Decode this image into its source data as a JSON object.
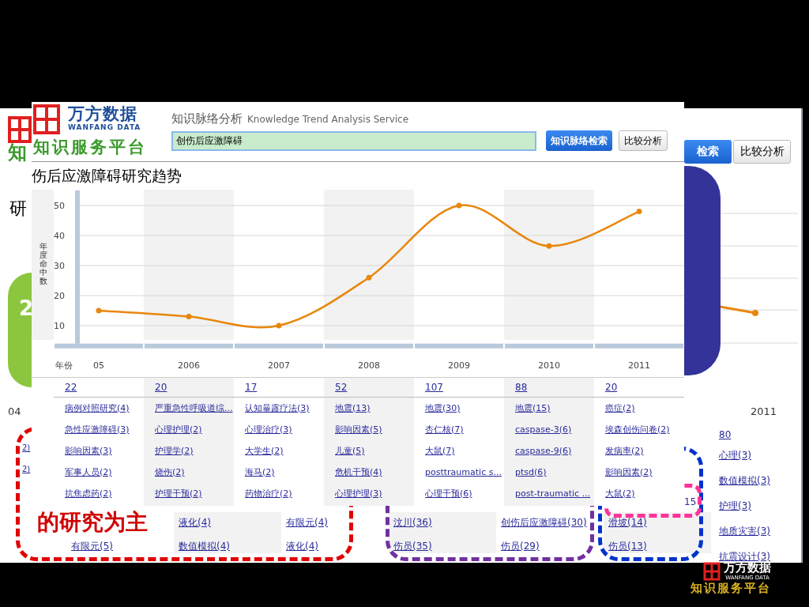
{
  "back_page": {
    "logo_fragment": "知",
    "title_fragment": "研",
    "search_button": "检索",
    "compare_button": "比较分析",
    "green_badge": "2",
    "year_fragment": "04",
    "year": "2011",
    "count": "80",
    "left_items": [
      "2)",
      "2)"
    ],
    "partial_count": "15",
    "right_items": [
      "心理(3)",
      "数值模拟(3)",
      "护理(3)",
      "地质灾害(3)",
      "抗震设计(3)"
    ],
    "bottom_columns": [
      {
        "items": [
          "有限元(5)"
        ]
      },
      {
        "items": [
          "液化(4)",
          "数值模拟(4)"
        ]
      },
      {
        "items": [
          "有限元(4)",
          "液化(4)"
        ]
      },
      {
        "items": [
          "汶川(36)",
          "伤员(35)"
        ]
      },
      {
        "items": [
          "创伤后应激障碍(30)",
          "伤员(29)"
        ]
      },
      {
        "items": [
          "滑坡(14)",
          "伤员(13)"
        ]
      }
    ]
  },
  "annotations": [
    {
      "kind": "dashed-box",
      "color": "#e00000"
    },
    {
      "kind": "dashed-box",
      "color": "#7030a0"
    },
    {
      "kind": "dashed-box",
      "color": "#0033cc"
    },
    {
      "kind": "dashed-box",
      "color": "#ff3399"
    },
    {
      "kind": "block",
      "color": "#333399"
    },
    {
      "kind": "caption",
      "text": "的研究为主"
    }
  ],
  "front_page": {
    "logo": {
      "name": "万方数据",
      "latin": "WANFANG DATA",
      "tagline": "知识服务平台"
    },
    "service_title": "知识脉络分析",
    "service_subtitle": "Knowledge Trend Analysis Service",
    "search": {
      "value": "创伤后应激障碍"
    },
    "buttons": [
      {
        "label": "知识脉络检索",
        "kind": "primary"
      },
      {
        "label": "比较分析",
        "kind": "secondary"
      }
    ],
    "chart_title": "伤后应激障碍研究趋势",
    "chart_data": {
      "type": "line",
      "xlabel": "年份",
      "ylabel": "年度命中数",
      "categories": [
        "05",
        "2006",
        "2007",
        "2008",
        "2009",
        "2010",
        "2011"
      ],
      "series": [
        {
          "color": "#e8870e",
          "values": [
            15,
            13,
            10,
            26,
            50,
            36.5,
            48
          ]
        }
      ],
      "ylim": [
        4,
        55
      ],
      "yticks": [
        10,
        20,
        30,
        40,
        50
      ],
      "grid": true,
      "marker": true
    },
    "years": [
      {
        "count": "22",
        "keywords": [
          "病例对照研究(4)",
          "急性应激障碍(3)",
          "影响因素(3)",
          "军事人员(2)",
          "抗焦虑药(2)"
        ]
      },
      {
        "count": "20",
        "keywords": [
          "严重急性呼吸道综...",
          "心理护理(2)",
          "护理学(2)",
          "烧伤(2)",
          "护理干预(2)"
        ]
      },
      {
        "count": "17",
        "keywords": [
          "认知暴露疗法(3)",
          "心理治疗(3)",
          "大学生(2)",
          "海马(2)",
          "药物治疗(2)"
        ]
      },
      {
        "count": "52",
        "keywords": [
          "地震(13)",
          "影响因素(5)",
          "儿童(5)",
          "危机干预(4)",
          "心理护理(3)"
        ]
      },
      {
        "count": "107",
        "keywords": [
          "地震(30)",
          "杏仁核(7)",
          "大鼠(7)",
          "posttraumatic s...",
          "心理干预(6)"
        ]
      },
      {
        "count": "88",
        "keywords": [
          "地震(15)",
          "caspase-3(6)",
          "caspase-9(6)",
          "ptsd(6)",
          "post-traumatic ..."
        ]
      },
      {
        "count": "20",
        "keywords": [
          "癌症(2)",
          "埃森创伤问卷(2)",
          "发病率(2)",
          "影响因素(2)",
          "大鼠(2)"
        ]
      }
    ]
  },
  "corner_logo": {
    "name": "万方数据",
    "latin": "WANFANG DATA",
    "tagline": "知识服务平台"
  }
}
